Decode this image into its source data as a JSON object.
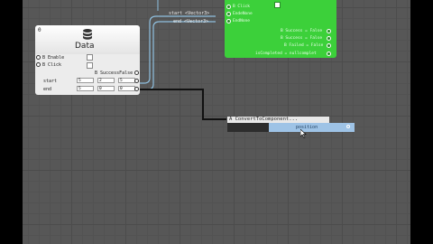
{
  "data_node": {
    "id": "0",
    "title": "Data",
    "icon": "database-icon",
    "rows": [
      {
        "label": "B Enable"
      },
      {
        "label": "B Click"
      }
    ],
    "output_label": "B SuccessFalse",
    "start": {
      "label": "start",
      "x": "5",
      "y": "2",
      "z": "5"
    },
    "end": {
      "label": "end",
      "x": "5",
      "y": "0",
      "z": "0"
    }
  },
  "wire_labels": {
    "start": "start <Vector3>",
    "end": "end <Vector3>"
  },
  "green_node": {
    "inputs": [
      "B Click",
      "EndeNone",
      "EndNone"
    ],
    "outputs": [
      "B Success = False",
      "B Success = False",
      "B Failed = False",
      "B Failed = False",
      "isCompleted = nullcomplet"
    ]
  },
  "popup": {
    "title": "A ConvertToComponent...",
    "selected": "position"
  },
  "colors": {
    "canvas": "#575757",
    "green": "#3cd03a",
    "wire_blue": "#8fc0e0"
  }
}
